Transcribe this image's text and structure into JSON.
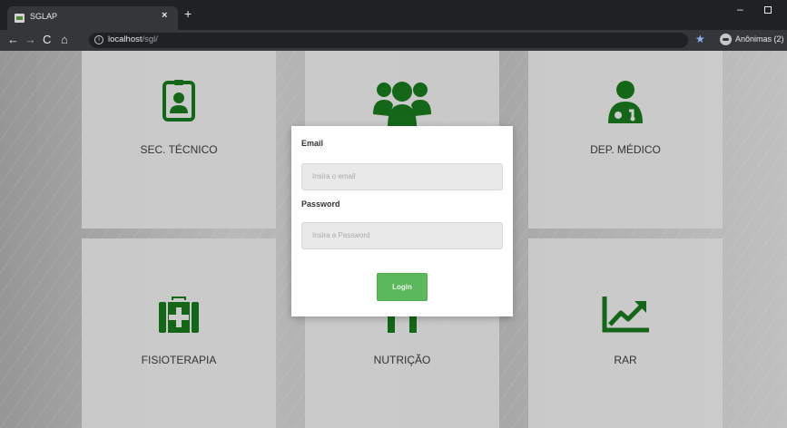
{
  "browser": {
    "tab_title": "SGLAP",
    "tab_close": "×",
    "new_tab": "+",
    "url_host": "localhost",
    "url_path": "/sgl/",
    "profile_label": "Anônimas (2)"
  },
  "page": {
    "cards": [
      {
        "label": "SEC. TÉCNICO",
        "icon": "id-badge-icon"
      },
      {
        "label": "",
        "icon": "users-icon"
      },
      {
        "label": "DEP. MÉDICO",
        "icon": "user-md-icon"
      },
      {
        "label": "FISIOTERAPIA",
        "icon": "medkit-icon"
      },
      {
        "label": "NUTRIÇÃO",
        "icon": "cutlery-icon"
      },
      {
        "label": "RAR",
        "icon": "line-chart-icon"
      }
    ],
    "icon_color": "#156a1a"
  },
  "login": {
    "email_label": "Email",
    "email_placeholder": "Insira o email",
    "password_label": "Password",
    "password_placeholder": "Insira a Password",
    "button_label": "Login",
    "button_color": "#5cb85c"
  }
}
